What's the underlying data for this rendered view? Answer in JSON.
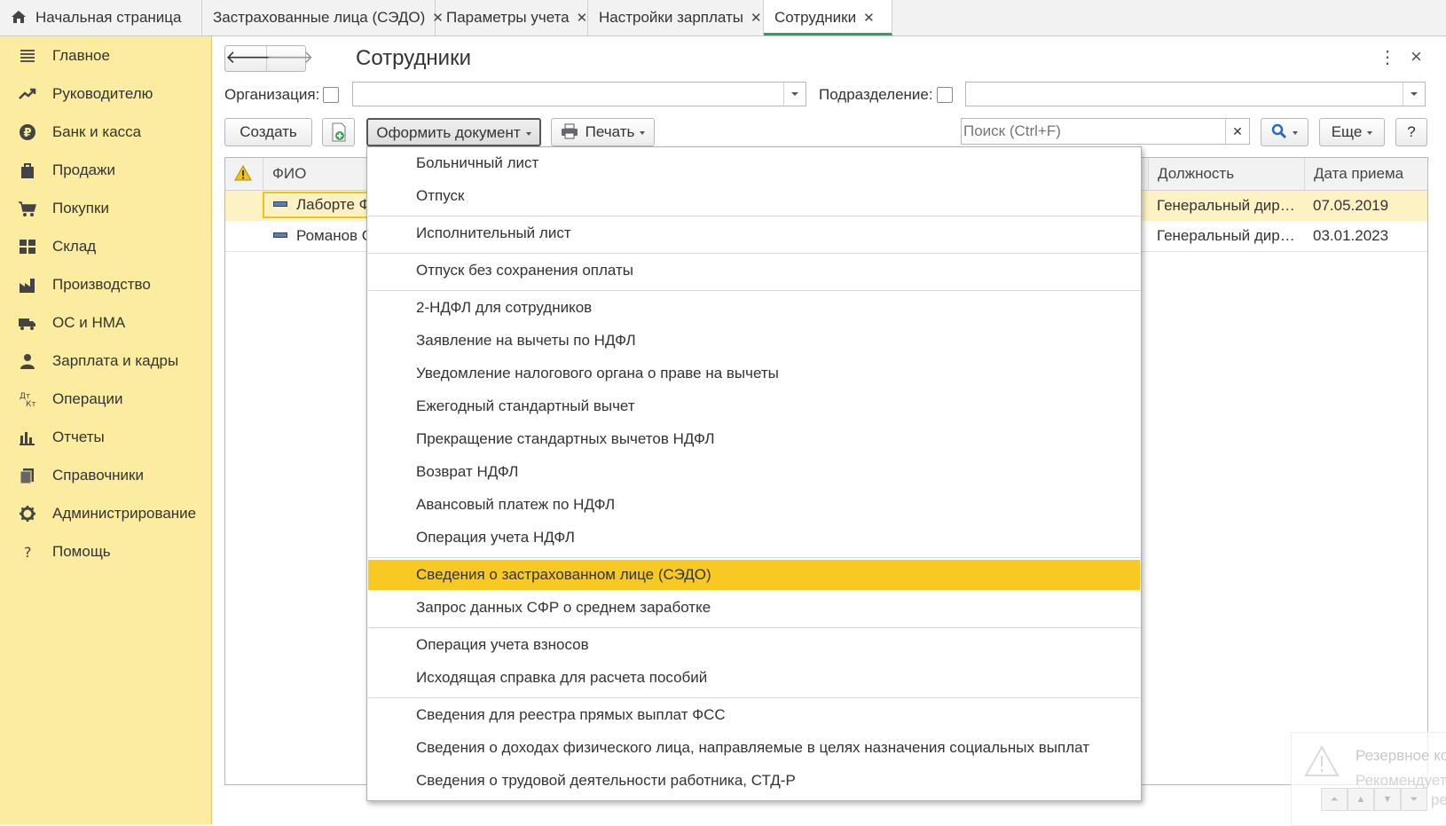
{
  "tabs": [
    {
      "label": "Начальная страница",
      "closable": false,
      "icon": "home-icon"
    },
    {
      "label": "Застрахованные лица (СЭДО)",
      "closable": true
    },
    {
      "label": "Параметры учета",
      "closable": true
    },
    {
      "label": "Настройки зарплаты",
      "closable": true
    },
    {
      "label": "Сотрудники",
      "closable": true,
      "active": true
    }
  ],
  "sidebar": {
    "items": [
      {
        "label": "Главное",
        "icon": "menu-lines-icon"
      },
      {
        "label": "Руководителю",
        "icon": "trend-icon"
      },
      {
        "label": "Банк и касса",
        "icon": "ruble-icon"
      },
      {
        "label": "Продажи",
        "icon": "bag-icon"
      },
      {
        "label": "Покупки",
        "icon": "cart-icon"
      },
      {
        "label": "Склад",
        "icon": "warehouse-icon"
      },
      {
        "label": "Производство",
        "icon": "factory-icon"
      },
      {
        "label": "ОС и НМА",
        "icon": "truck-icon"
      },
      {
        "label": "Зарплата и кадры",
        "icon": "person-icon"
      },
      {
        "label": "Операции",
        "icon": "dt-kt-icon"
      },
      {
        "label": "Отчеты",
        "icon": "bar-chart-icon"
      },
      {
        "label": "Справочники",
        "icon": "books-icon"
      },
      {
        "label": "Администрирование",
        "icon": "gear-icon"
      },
      {
        "label": "Помощь",
        "icon": "question-icon"
      }
    ]
  },
  "form": {
    "title": "Сотрудники",
    "org_label": "Организация:",
    "org_value": "",
    "dept_label": "Подразделение:",
    "dept_value": "",
    "create_label": "Создать",
    "doc_label": "Оформить документ",
    "print_label": "Печать",
    "search_placeholder": "Поиск (Ctrl+F)",
    "more_label": "Еще",
    "help_label": "?",
    "more_menu": "⋮",
    "close": "×"
  },
  "table": {
    "columns": {
      "fio": "ФИО",
      "position": "Должность",
      "hire_date": "Дата приема"
    },
    "rows": [
      {
        "fio": "Лаборте Ф",
        "position": "Генеральный дир…",
        "hire_date": "07.05.2019",
        "selected": true
      },
      {
        "fio": "Романов С",
        "position": "Генеральный дир…",
        "hire_date": "03.01.2023",
        "selected": false
      }
    ]
  },
  "menu": {
    "groups": [
      [
        "Больничный лист",
        "Отпуск"
      ],
      [
        "Исполнительный лист"
      ],
      [
        "Отпуск без сохранения оплаты"
      ],
      [
        "2-НДФЛ для сотрудников",
        "Заявление на вычеты по НДФЛ",
        "Уведомление налогового органа о праве на вычеты",
        "Ежегодный стандартный вычет",
        "Прекращение стандартных вычетов НДФЛ",
        "Возврат НДФЛ",
        "Авансовый платеж по НДФЛ",
        "Операция учета НДФЛ"
      ],
      [
        "Сведения о застрахованном лице (СЭДО)",
        "Запрос данных СФР о среднем заработке"
      ],
      [
        "Операция учета взносов",
        "Исходящая справка для расчета пособий"
      ],
      [
        "Сведения для реестра прямых выплат ФСС",
        "Сведения о доходах физического лица, направляемые в целях назначения социальных выплат",
        "Сведения о трудовой деятельности работника, СТД-Р"
      ]
    ],
    "highlighted": "Сведения о застрахованном лице (СЭДО)"
  },
  "notification": {
    "title": "Резервное ко",
    "text": "Рекомендуется",
    "text2": "настроить рез"
  },
  "colors": {
    "sidebar": "#fbec9f",
    "highlight": "#f8c923",
    "active_tab_underline": "#2e9e6a"
  }
}
